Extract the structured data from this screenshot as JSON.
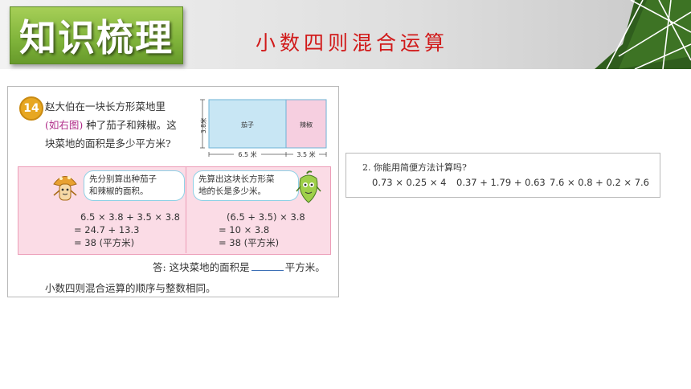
{
  "header": {
    "badge_text": "知识梳理",
    "section_title": "小数四则混合运算"
  },
  "problem": {
    "number": "14",
    "line1": "赵大伯在一块长方形菜地里",
    "line2_paren": "(如右图)",
    "line2_rest": " 种了茄子和辣椒。这",
    "line3": "块菜地的面积是多少平方米?",
    "diagram": {
      "left_label": "茄子",
      "right_label": "辣椒",
      "height_label": "3.8米",
      "left_width_label": "6.5 米",
      "right_width_label": "3.5 米"
    },
    "method_left": {
      "bubble_line1": "先分别算出种茄子",
      "bubble_line2": "和辣椒的面积。",
      "step1": "6.5 × 3.8 + 3.5 × 3.8",
      "step2": "= 24.7 + 13.3",
      "step3": "= 38 (平方米)"
    },
    "method_right": {
      "bubble_line1": "先算出这块长方形菜",
      "bubble_line2": "地的长是多少米。",
      "step1": "(6.5 + 3.5) × 3.8",
      "step2": "= 10 × 3.8",
      "step3": "= 38 (平方米)"
    },
    "answer_prefix": "答: 这块菜地的面积是",
    "answer_suffix": "平方米。",
    "summary": "小数四则混合运算的顺序与整数相同。"
  },
  "exercise": {
    "title": "2. 你能用简便方法计算吗?",
    "expr1": "0.73 × 0.25 × 4",
    "expr2": "0.37 + 1.79 + 0.63",
    "expr3": "7.6 × 0.8 + 0.2 × 7.6"
  },
  "colors": {
    "badge_green": "#7fb33a",
    "section_title_red": "#d11a1a",
    "eggplant_blue": "#c8e6f4",
    "pepper_pink": "#f6cfe0",
    "method_pink": "#fbdce6"
  }
}
